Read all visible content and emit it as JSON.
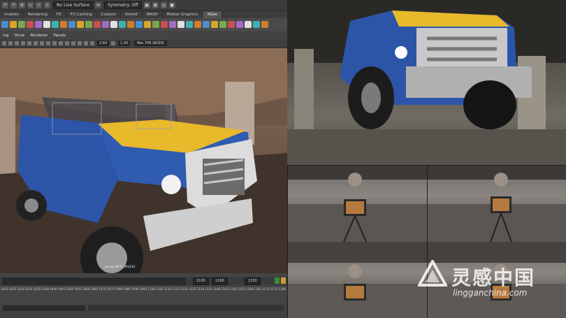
{
  "maya": {
    "status_line": {
      "surface_field": "No Live Surface",
      "symmetry_field": "Symmetry: Off"
    },
    "shelf_tabs": [
      "imation",
      "Rendering",
      "FX",
      "FX Caching",
      "Custom",
      "Arnold",
      "MASH",
      "Motion Graphics",
      "XGen"
    ],
    "shelf_icons": [
      "sphere-light-icon",
      "xyz-icon",
      "poly-icon",
      "gear-icon",
      "cube-icon",
      "sphere-icon",
      "cylinder-icon",
      "plane-icon",
      "torus-icon",
      "cone-icon",
      "arrow-icon",
      "scale-icon",
      "camera-icon",
      "light-icon",
      "area-light-icon",
      "curve-icon",
      "bend-icon",
      "lattice-icon",
      "render-icon",
      "ipr-icon",
      "hypershade-icon",
      "uv-icon",
      "paint-icon",
      "sculpt-icon",
      "move-icon",
      "rotate-icon",
      "select-icon",
      "lock-icon",
      "frame-icon",
      "pivot-icon",
      "snap-icon",
      "bridge-icon"
    ],
    "panel_menu": [
      "ing",
      "Show",
      "Renderer",
      "Panels"
    ],
    "view_toolbar": {
      "exposure": "2.60",
      "gamma": "1.00",
      "color_space": "Rec.709 (ACES)"
    },
    "viewport_label": "persp (RFY_TRUCK)",
    "timeline_ticks": [
      "1020",
      "1025",
      "1030",
      "1032",
      "1035",
      "1038",
      "1040",
      "1045",
      "1050",
      "1055",
      "1060",
      "1065",
      "1070",
      "1075",
      "1080",
      "1085",
      "1090",
      "1095",
      "1100",
      "1105",
      "1110",
      "1115",
      "1120",
      "1125",
      "1130",
      "1135",
      "1140",
      "1145",
      "1150",
      "1155",
      "1160",
      "1165",
      "1170",
      "1175",
      "1180",
      "1185",
      "1190"
    ],
    "range": {
      "end_field": "1100",
      "playback_end": "1100",
      "animation_end": "1150"
    }
  },
  "watermark": {
    "brand": "灵感中国",
    "url": "lingganchina.com"
  },
  "colors": {
    "ui_bg": "#444444",
    "truck_blue": "#2c55a8",
    "truck_yellow": "#e7b92b"
  }
}
